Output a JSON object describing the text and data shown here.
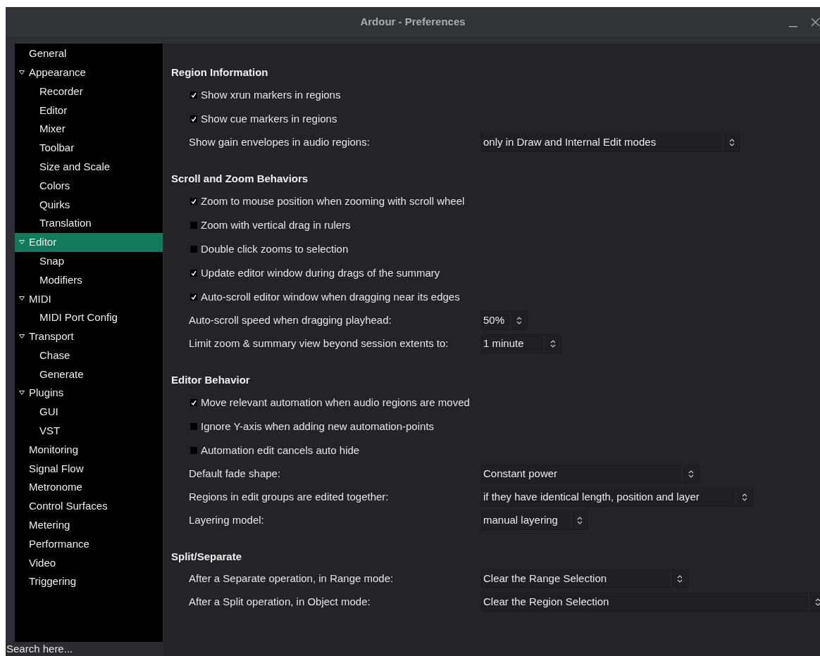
{
  "window": {
    "title": "Ardour - Preferences"
  },
  "sidebar": {
    "items": [
      {
        "label": "General",
        "selected": false
      },
      {
        "label": "Appearance",
        "selected": false,
        "expanded": true,
        "children": [
          {
            "label": "Recorder",
            "selected": false
          },
          {
            "label": "Editor",
            "selected": false
          },
          {
            "label": "Mixer",
            "selected": false
          },
          {
            "label": "Toolbar",
            "selected": false
          },
          {
            "label": "Size and Scale",
            "selected": false
          },
          {
            "label": "Colors",
            "selected": false
          },
          {
            "label": "Quirks",
            "selected": false
          },
          {
            "label": "Translation",
            "selected": false
          }
        ]
      },
      {
        "label": "Editor",
        "selected": true,
        "expanded": true,
        "children": [
          {
            "label": "Snap",
            "selected": false
          },
          {
            "label": "Modifiers",
            "selected": false
          }
        ]
      },
      {
        "label": "MIDI",
        "selected": false,
        "expanded": true,
        "children": [
          {
            "label": "MIDI Port Config",
            "selected": false
          }
        ]
      },
      {
        "label": "Transport",
        "selected": false,
        "expanded": true,
        "children": [
          {
            "label": "Chase",
            "selected": false
          },
          {
            "label": "Generate",
            "selected": false
          }
        ]
      },
      {
        "label": "Plugins",
        "selected": false,
        "expanded": true,
        "children": [
          {
            "label": "GUI",
            "selected": false
          },
          {
            "label": "VST",
            "selected": false
          }
        ]
      },
      {
        "label": "Monitoring",
        "selected": false
      },
      {
        "label": "Signal Flow",
        "selected": false
      },
      {
        "label": "Metronome",
        "selected": false
      },
      {
        "label": "Control Surfaces",
        "selected": false
      },
      {
        "label": "Metering",
        "selected": false
      },
      {
        "label": "Performance",
        "selected": false
      },
      {
        "label": "Video",
        "selected": false
      },
      {
        "label": "Triggering",
        "selected": false
      }
    ],
    "search": {
      "placeholder": "Search here..."
    }
  },
  "sections": [
    {
      "heading": "Region Information",
      "rows": [
        {
          "kind": "checkbox",
          "label": "Show xrun markers in regions",
          "checked": true
        },
        {
          "kind": "checkbox",
          "label": "Show cue markers in regions",
          "checked": true
        },
        {
          "kind": "select",
          "label": "Show gain envelopes in audio regions:",
          "value": "only in Draw and Internal Edit modes"
        }
      ]
    },
    {
      "heading": "Scroll and Zoom Behaviors",
      "rows": [
        {
          "kind": "checkbox",
          "label": "Zoom to mouse position when zooming with scroll wheel",
          "checked": true
        },
        {
          "kind": "checkbox",
          "label": "Zoom with vertical drag in rulers",
          "checked": false
        },
        {
          "kind": "checkbox",
          "label": "Double click zooms to selection",
          "checked": false
        },
        {
          "kind": "checkbox",
          "label": "Update editor window during drags of the summary",
          "checked": true
        },
        {
          "kind": "checkbox",
          "label": "Auto-scroll editor window when dragging near its edges",
          "checked": true
        },
        {
          "kind": "select",
          "label": "Auto-scroll speed when dragging playhead:",
          "value": "50%"
        },
        {
          "kind": "select",
          "label": "Limit zoom & summary view beyond session extents to:",
          "value": "1 minute"
        }
      ]
    },
    {
      "heading": "Editor Behavior",
      "rows": [
        {
          "kind": "checkbox",
          "label": "Move relevant automation when audio regions are moved",
          "checked": true
        },
        {
          "kind": "checkbox",
          "label": "Ignore Y-axis when adding new automation-points",
          "checked": false
        },
        {
          "kind": "checkbox",
          "label": "Automation edit cancels auto hide",
          "checked": false
        },
        {
          "kind": "select",
          "label": "Default fade shape:",
          "value": "Constant power"
        },
        {
          "kind": "select",
          "label": "Regions in edit groups are edited together:",
          "value": "if they have identical length, position and layer"
        },
        {
          "kind": "select",
          "label": "Layering model:",
          "value": "manual layering"
        }
      ]
    },
    {
      "heading": "Split/Separate",
      "rows": [
        {
          "kind": "select",
          "label": "After a Separate operation, in Range mode:",
          "value": "Clear the Range Selection"
        },
        {
          "kind": "select",
          "label": "After a Split operation, in Object mode:",
          "value": "Clear the Region Selection"
        }
      ]
    }
  ]
}
